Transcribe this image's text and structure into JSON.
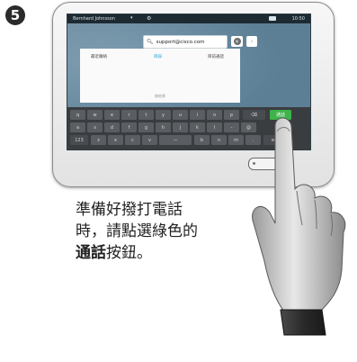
{
  "step_number": "5",
  "status_bar": {
    "user": "Bernhard Johnsson",
    "caret": "▾",
    "time": "10:50"
  },
  "search": {
    "value": "support@cisco.com",
    "clear_icon": "clear-x",
    "next": "›"
  },
  "tabs": [
    {
      "label": "最近聯絡",
      "active": false
    },
    {
      "label": "目錄",
      "active": true
    },
    {
      "label": "目前通話",
      "active": false
    }
  ],
  "panel_footer": "無結果",
  "keyboard": {
    "row1": [
      "q",
      "w",
      "e",
      "r",
      "t",
      "y",
      "u",
      "i",
      "o",
      "p"
    ],
    "backspace_icon": "backspace-icon",
    "call_label": "通話",
    "row2": [
      "a",
      "s",
      "d",
      "f",
      "g",
      "h",
      "j",
      "k",
      "l",
      "-",
      "@"
    ],
    "row3_left": "123",
    "row3": [
      "z",
      "x",
      "c",
      "v",
      "b",
      "n",
      "m",
      "."
    ],
    "row3_right": "enter"
  },
  "caption": {
    "line1": "準備好撥打電話",
    "line2": "時，請點選綠色的",
    "line3_bold": "通話",
    "line3_rest": "按鈕。"
  },
  "colors": {
    "call_green": "#3db34a",
    "active_tab": "#2aa7d8"
  }
}
